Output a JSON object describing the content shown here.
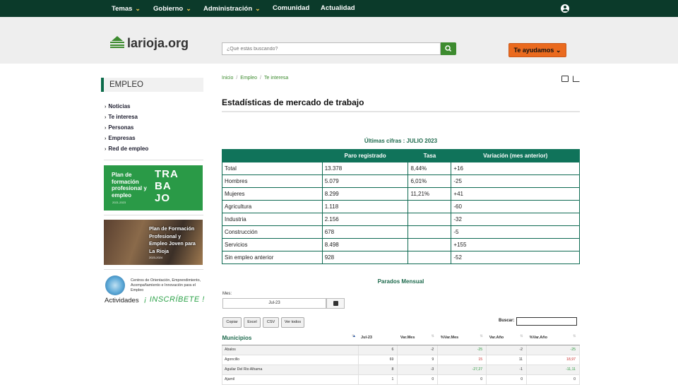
{
  "nav": {
    "items": [
      "Temas",
      "Gobierno",
      "Administración",
      "Comunidad",
      "Actualidad"
    ]
  },
  "header": {
    "logo": "larioja.org",
    "search_placeholder": "¿Qué estás buscando?",
    "help_label": "Te ayudamos"
  },
  "sidebar": {
    "title": "EMPLEO",
    "links": [
      "Noticias",
      "Te interesa",
      "Personas",
      "Empresas",
      "Red de empleo"
    ],
    "banner1": {
      "text": "Plan de formación profesional y empleo",
      "years": "2021-2023",
      "big": "TRA BA JO"
    },
    "banner2": {
      "text": "Plan de Formación Profesional y Empleo Joven para La Rioja",
      "years": "2023-2024"
    },
    "centros": "Centros de Orientación, Emprendimiento, Acompañamiento e Innovación para el Empleo",
    "actividades": "Actividades",
    "inscribete": "¡ INSCRÍBETE !"
  },
  "breadcrumb": [
    "Inicio",
    "Empleo",
    "Te interesa"
  ],
  "page_title": "Estadísticas de mercado de trabajo",
  "ultimas": {
    "title": "Últimas cifras : JULIO 2023",
    "headers": [
      "",
      "Paro registrado",
      "Tasa",
      "Variación (mes anterior)"
    ],
    "rows": [
      [
        "Total",
        "13.378",
        "8,44%",
        "+16"
      ],
      [
        "Hombres",
        "5.079",
        "6,01%",
        "-25"
      ],
      [
        "Mujeres",
        "8.299",
        "11,21%",
        "+41"
      ],
      [
        "Agricultura",
        "1.118",
        "",
        "-60"
      ],
      [
        "Industria",
        "2.156",
        "",
        "-32"
      ],
      [
        "Construcción",
        "678",
        "",
        "-5"
      ],
      [
        "Servicios",
        "8.498",
        "",
        "+155"
      ],
      [
        "Sin empleo anterior",
        "928",
        "",
        "-52"
      ]
    ]
  },
  "parados": {
    "title": "Parados Mensual",
    "mes_label": "Mes:",
    "mes_value": "Jul-23",
    "buttons": [
      "Copiar",
      "Excel",
      "CSV",
      "Ver todos"
    ],
    "buscar_label": "Buscar:",
    "headers": [
      "Municipios",
      "Jul-23",
      "Var.Mes",
      "%Var.Mes",
      "Var.Año",
      "%Var.Año"
    ],
    "rows": [
      [
        "Abalos",
        "6",
        "-2",
        "-25",
        "-2",
        "-25"
      ],
      [
        "Agoncillo",
        "69",
        "9",
        "15",
        "11",
        "18,97"
      ],
      [
        "Aguilar Del Rio Alhama",
        "8",
        "-3",
        "-27,27",
        "-1",
        "-11,11"
      ],
      [
        "Ajamil",
        "1",
        "0",
        "0",
        "0",
        "0"
      ]
    ]
  }
}
